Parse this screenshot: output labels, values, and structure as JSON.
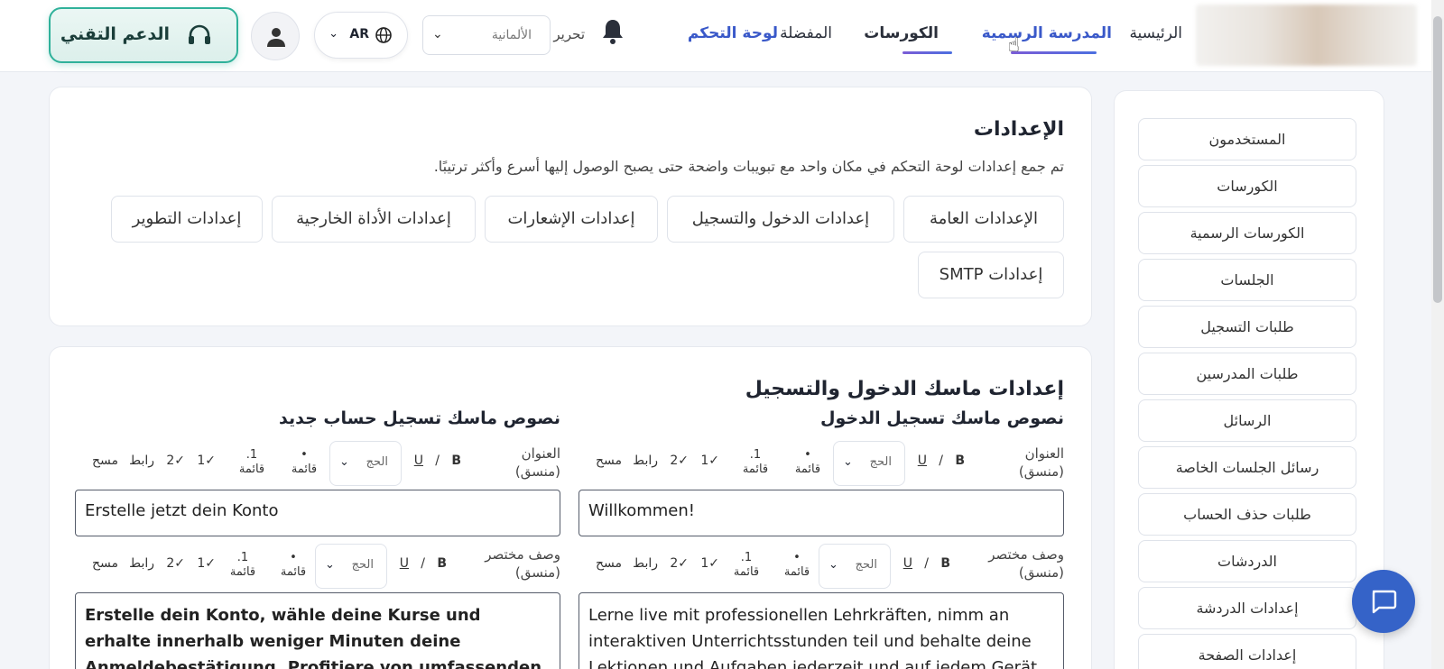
{
  "nav": {
    "home": "الرئيسية",
    "official_school": "المدرسة الرسمية",
    "courses": "الكورسات",
    "favorites": "المفضلة",
    "dashboard": "لوحة التحكم"
  },
  "header": {
    "edit_label": "تحرير",
    "language_select_value": "الألمانية",
    "locale_code": "AR",
    "support_label": "الدعم التقني"
  },
  "sidebar": {
    "items": [
      "المستخدمون",
      "الكورسات",
      "الكورسات الرسمية",
      "الجلسات",
      "طلبات التسجيل",
      "طلبات المدرسين",
      "الرسائل",
      "رسائل الجلسات الخاصة",
      "طلبات حذف الحساب",
      "الدردشات",
      "إعدادات الدردشة",
      "إعدادات الصفحة"
    ]
  },
  "settings": {
    "title": "الإعدادات",
    "description": "تم جمع إعدادات لوحة التحكم في مكان واحد مع تبويبات واضحة حتى يصبح الوصول إليها أسرع وأكثر ترتيبًا.",
    "tabs": {
      "general": "الإعدادات العامة",
      "login_signup": "إعدادات الدخول والتسجيل",
      "notifications": "إعدادات الإشعارات",
      "external_tool": "إعدادات الأداة الخارجية",
      "development": "إعدادات التطوير",
      "smtp": "إعدادات SMTP"
    }
  },
  "login_mask": {
    "section_title": "إعدادات ماسك الدخول والتسجيل",
    "login_column_title": "نصوص ماسك تسجيل الدخول",
    "signup_column_title": "نصوص ماسك تسجيل حساب جديد",
    "toolbar": {
      "title_label_line1": "العنوان",
      "title_label_line2": "(منسق)",
      "desc_label_line1": "وصف مختصر",
      "desc_label_line2": "(منسق)",
      "bold": "B",
      "italic": "/",
      "underline": "U",
      "size_value": "الحج",
      "bullet_symbol": "•",
      "list_label": "قائمة",
      "numbered_symbol": "1.",
      "check1": "✓1",
      "check2": "✓2",
      "link": "رابط",
      "clear": "مسح"
    },
    "login_title_value": "Willkommen!",
    "signup_title_value": "Erstelle jetzt dein Konto",
    "login_desc_value": "Lerne live mit professionellen Lehrkräften, nimm an interaktiven Unterrichtsstunden teil und behalte deine Lektionen und Aufgaben jederzeit und auf jedem Gerät",
    "signup_desc_value": "Erstelle dein Konto, wähle deine Kurse und erhalte innerhalb weniger Minuten deine Anmeldebestätigung. Profitiere von umfassenden Bildungsangeboten und"
  }
}
